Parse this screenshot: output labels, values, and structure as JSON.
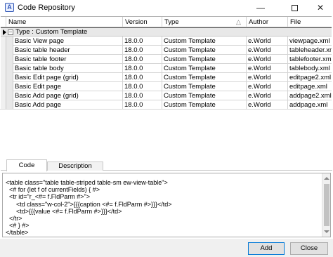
{
  "window": {
    "title": "Code Repository",
    "icon": "app-icon"
  },
  "grid": {
    "columns": [
      "Name",
      "Version",
      "Type",
      "Author",
      "File"
    ],
    "group_label": "Type : Custom Template",
    "rows": [
      [
        "Basic View page",
        "18.0.0",
        "Custom Template",
        "e.World",
        "viewpage.xml"
      ],
      [
        "Basic table header",
        "18.0.0",
        "Custom Template",
        "e.World",
        "tableheader.xml"
      ],
      [
        "Basic table footer",
        "18.0.0",
        "Custom Template",
        "e.World",
        "tablefooter.xml"
      ],
      [
        "Basic table body",
        "18.0.0",
        "Custom Template",
        "e.World",
        "tablebody.xml"
      ],
      [
        "Basic Edit page (grid)",
        "18.0.0",
        "Custom Template",
        "e.World",
        "editpage2.xml"
      ],
      [
        "Basic Edit page",
        "18.0.0",
        "Custom Template",
        "e.World",
        "editpage.xml"
      ],
      [
        "Basic Add page (grid)",
        "18.0.0",
        "Custom Template",
        "e.World",
        "addpage2.xml"
      ],
      [
        "Basic Add page",
        "18.0.0",
        "Custom Template",
        "e.World",
        "addpage.xml"
      ]
    ]
  },
  "tabs": [
    "Code",
    "Description"
  ],
  "code": "<table class=\"table table-striped table-sm ew-view-table\">\n  <# for (let f of currentFields) { #>\n  <tr id=\"r_<#= f.FldParm #>\">\n      <td class=\"w-col-2\">{{{caption <#= f.FldParm #>}}}</td>\n      <td>{{{value <#= f.FldParm #>}}}</td>\n  </tr>\n  <# } #>\n</table>",
  "buttons": {
    "add": "Add",
    "close": "Close"
  }
}
